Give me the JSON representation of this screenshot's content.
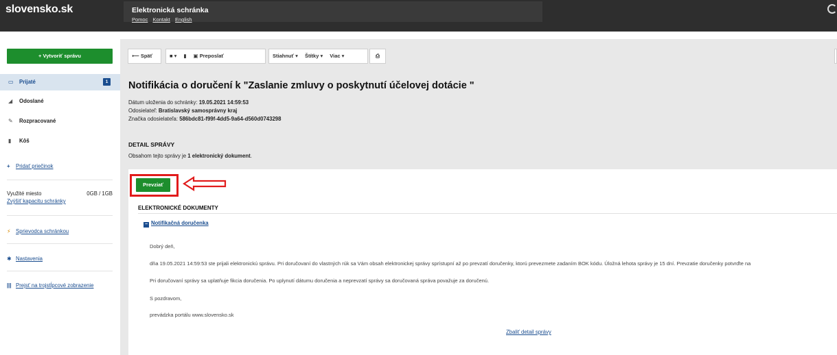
{
  "header": {
    "logo": "slovensko.sk",
    "app_title": "Elektronická schránka",
    "links": [
      "Pomoc",
      "Kontakt",
      "English"
    ]
  },
  "sidebar": {
    "new_message": "+ Vytvoriť správu",
    "items": [
      {
        "label": "Prijaté",
        "icon": "inbox-icon",
        "badge": "1",
        "active": true
      },
      {
        "label": "Odoslané",
        "icon": "send-icon"
      },
      {
        "label": "Rozpracované",
        "icon": "pencil-icon"
      },
      {
        "label": "Kôš",
        "icon": "trash-icon"
      }
    ],
    "add_folder": "Pridať priečinok",
    "storage_label": "Využité miesto",
    "storage_value": "0GB / 1GB",
    "storage_link": "Zvýšiť kapacitu schránky",
    "guide": "Sprievodca schránkou",
    "settings": "Nastavenia",
    "three_col": "Prejsť na trojstĺpcové zobrazenie"
  },
  "toolbar": {
    "back": "⟵ Späť",
    "folder": "▾",
    "forward": "Preposlať",
    "download": "Stiahnuť",
    "tags": "Štítky",
    "more": "Viac"
  },
  "message": {
    "title": "Notifikácia o doručení k \"Zaslanie zmluvy o poskytnutí účelovej dotácie \"",
    "date_label": "Dátum uloženia do schránky:",
    "date_value": "19.05.2021 14:59:53",
    "sender_label": "Odosielateľ:",
    "sender_value": "Bratislavský samosprávny kraj",
    "mark_label": "Značka odosielateľa:",
    "mark_value": "586bdc81-f99f-4dd5-9a64-d560d0743298",
    "detail_title": "DETAIL SPRÁVY",
    "contains_prefix": "Obsahom tejto správy je",
    "contains_value": "1 elektronický dokument",
    "contains_suffix": "."
  },
  "documents": {
    "accept_button": "Prevziať",
    "section_title": "ELEKTRONICKÉ DOKUMENTY",
    "doc_name": "Notifikačná doručenka",
    "lines": [
      "Dobrý deň,",
      "dňa 19.05.2021 14:59:53 ste prijali elektronickú správu. Pri doručovaní do vlastných rúk sa Vám obsah elektronickej správy sprístupní až po prevzatí doručenky, ktorú prevezmete zadaním BOK kódu. Úložná lehota správy je 15 dní. Prevzatie doručenky potvrďte na",
      "Pri doručovaní správy sa uplatňuje fikcia doručenia. Po uplynutí dátumu doručenia a neprevzatí správy sa doručovaná správa považuje za doručenú.",
      "S pozdravom,",
      "prevádzka portálu www.slovensko.sk"
    ],
    "collapse_link": "Zbaliť detail správy"
  },
  "colors": {
    "header_bg": "#2e2e2e",
    "primary_green": "#1d8e2d",
    "link_blue": "#1a4d8f",
    "highlight_red": "#e11b1b",
    "main_bg": "#e8e8e8"
  }
}
